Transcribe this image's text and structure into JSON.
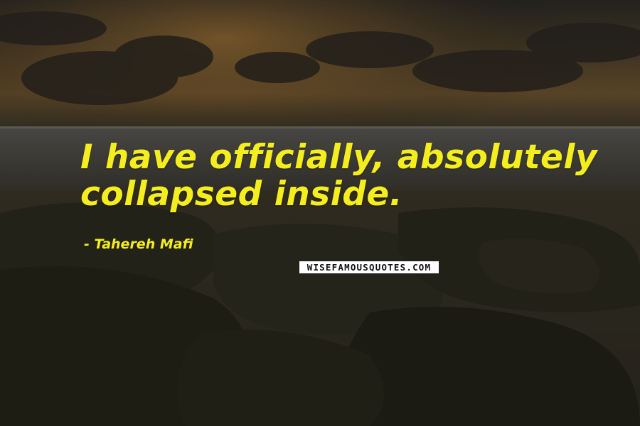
{
  "quote": {
    "line1": "I have officially, absolutely",
    "line2": "collapsed inside."
  },
  "author": "- Tahereh Mafi",
  "watermark": "WISEFAMOUSQUOTES.COM",
  "colors": {
    "quote_text": "#f5ee1e",
    "background_sky": "#3a3322",
    "background_rocks": "#2a281c"
  }
}
